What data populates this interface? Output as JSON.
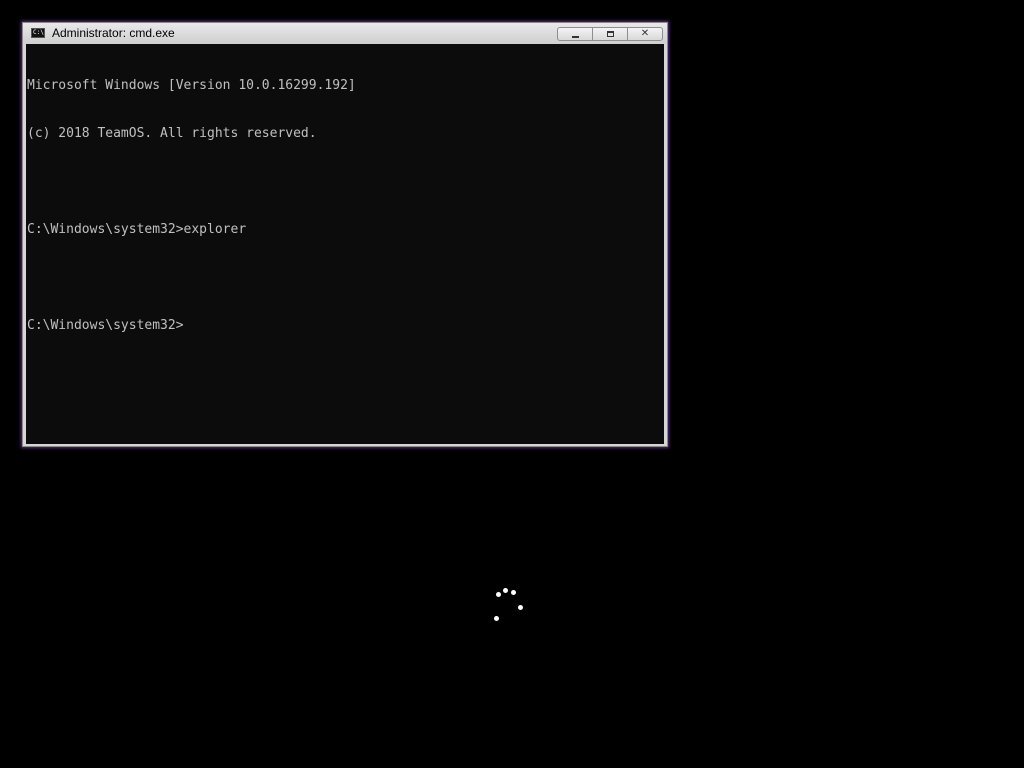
{
  "window": {
    "title": "Administrator: cmd.exe",
    "icon": "cmd-icon",
    "icon_text": "C:\\",
    "buttons": {
      "minimize": "minimize-icon",
      "maximize": "maximize-icon",
      "close": "close-icon",
      "close_glyph": "✕"
    }
  },
  "console": {
    "lines": [
      "Microsoft Windows [Version 10.0.16299.192]",
      "(c) 2018 TeamOS. All rights reserved.",
      "",
      "C:\\Windows\\system32>explorer",
      "",
      "C:\\Windows\\system32>"
    ],
    "background": "#0c0c0c",
    "foreground": "#c0c0c0"
  },
  "spinner": {
    "icon": "loading-spinner-icon",
    "color": "#ffffff"
  },
  "colors": {
    "desktop": "#000000",
    "window_glow": "#a05adc"
  }
}
